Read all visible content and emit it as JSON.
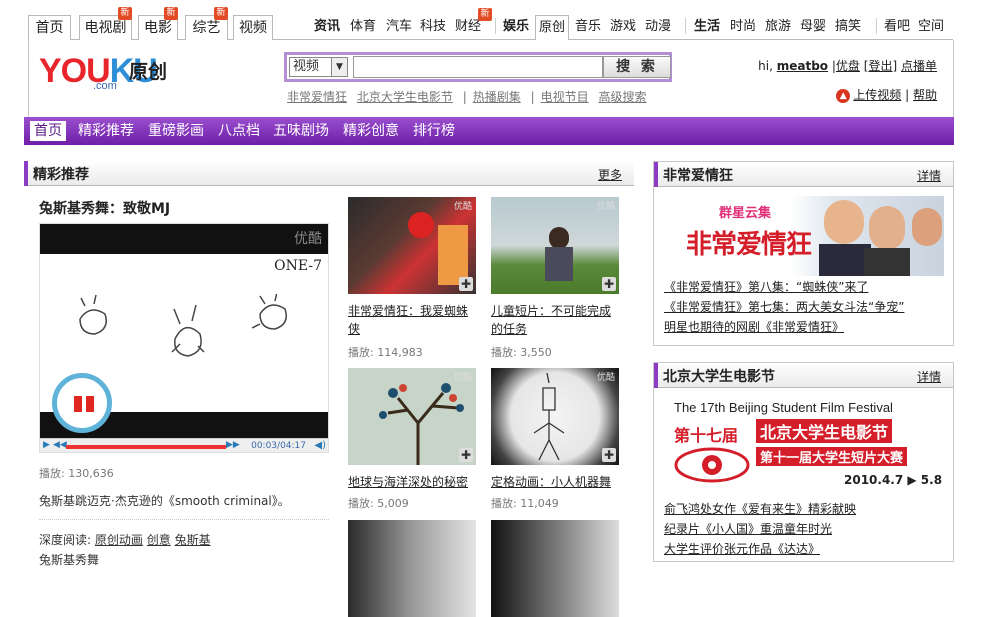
{
  "topnav": {
    "tabs": [
      {
        "label": "首页"
      },
      {
        "label": "电视剧",
        "badge": "新"
      },
      {
        "label": "电影",
        "badge": "新"
      },
      {
        "label": "综艺",
        "badge": "新"
      },
      {
        "label": "视频"
      }
    ],
    "group1": [
      "资讯",
      "体育",
      "汽车",
      "科技",
      "财经"
    ],
    "group1_badge": "新",
    "group2": [
      "娱乐",
      "原创",
      "音乐",
      "游戏",
      "动漫"
    ],
    "group3": [
      "生活",
      "时尚",
      "旅游",
      "母婴",
      "搞笑"
    ],
    "group4": [
      "看吧",
      "空间"
    ]
  },
  "header": {
    "logo_you": "YOU",
    "logo_ku": "KU",
    "logo_com": ".com",
    "logo_section": "原创",
    "search_select": "视频",
    "search_value": "",
    "search_button": "搜 索",
    "hot_links": [
      "非常爱情狂",
      "北京大学生电影节",
      "热播剧集",
      "电视节目",
      "高级搜索"
    ],
    "user_hi": "hi,",
    "user_name": "meatbo",
    "user_links": [
      "优盘",
      "登出",
      "点播单"
    ],
    "upload": "上传视频",
    "help": "帮助"
  },
  "subnav": [
    "首页",
    "精彩推荐",
    "重磅影画",
    "八点档",
    "五味剧场",
    "精彩创意",
    "排行榜"
  ],
  "featured": {
    "section_title": "精彩推荐",
    "more": "更多",
    "main_title": "兔斯基秀舞：致敬MJ",
    "player_watermark": "优酷",
    "player_caption": "ONE-7",
    "player_time": "00:03/04:17",
    "plays": "播放: 130,636",
    "description": "兔斯基跳迈克·杰克逊的《smooth criminal》。",
    "related_label": "深度阅读:",
    "related_tags": [
      "原创动画",
      "创意",
      "兔斯基"
    ],
    "bottom_cut_text": "兔斯基秀舞"
  },
  "videos": [
    {
      "title": "非常爱情狂：我爱蜘蛛侠",
      "plays": "播放: 114,983"
    },
    {
      "title": "儿童短片：不可能完成的任务",
      "plays": "播放: 3,550"
    },
    {
      "title": "地球与海洋深处的秘密",
      "plays": "播放: 5,009"
    },
    {
      "title": "定格动画：小人机器舞",
      "plays": "播放: 11,049"
    }
  ],
  "panel1": {
    "title": "非常爱情狂",
    "more": "详情",
    "banner_top": "群星云集",
    "banner_main": "非常爱情狂",
    "links": [
      "《非常爱情狂》第八集：“蜘蛛侠”来了",
      "《非常爱情狂》第七集：两大美女斗法“争宠”",
      "明星也期待的网剧《非常爱情狂》"
    ]
  },
  "panel2": {
    "title": "北京大学生电影节",
    "more": "详情",
    "banner_en": "The 17th Beijing Student Film Festival",
    "banner_cn1": "第十七届",
    "banner_cn2": "北京大学生电影节",
    "banner_cn3": "第十一届大学生短片大赛",
    "banner_date": "2010.4.7 ▶ 5.8",
    "links": [
      "俞飞鸿处女作《爱有来生》精彩献映",
      "纪录片《小人国》重温童年时光",
      "大学生评价张元作品《达达》"
    ]
  },
  "colors": {
    "accent": "#7b2fb3",
    "logo_red": "#e8252a",
    "badge": "#e24b24"
  }
}
